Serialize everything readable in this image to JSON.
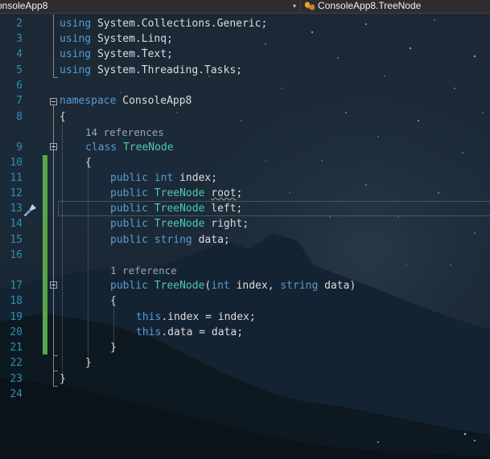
{
  "navbar": {
    "project_label": "onsoleApp8",
    "dropdown_arrow": "▾",
    "type_label": "ConsoleApp8.TreeNode",
    "type_icon": "class-icon"
  },
  "editor": {
    "line_numbers": [
      "2",
      "3",
      "4",
      "5",
      "6",
      "7",
      "8",
      "9",
      "10",
      "11",
      "12",
      "13",
      "14",
      "15",
      "16",
      "17",
      "18",
      "19",
      "20",
      "21",
      "22",
      "23",
      "24"
    ],
    "codelens": {
      "class_refs": "14 references",
      "ctor_refs": "1 reference"
    },
    "line_2": {
      "kw": "using",
      "rest": "System.Collections.Generic;"
    },
    "line_3": {
      "kw": "using",
      "rest": "System.Linq;"
    },
    "line_4": {
      "kw": "using",
      "rest": "System.Text;"
    },
    "line_5": {
      "kw": "using",
      "rest": "System.Threading.Tasks;"
    },
    "line_7": {
      "kw": "namespace",
      "name": "ConsoleApp8"
    },
    "line_8": {
      "brace": "{"
    },
    "line_9": {
      "kw": "class",
      "name": "TreeNode"
    },
    "line_10": {
      "brace": "{"
    },
    "line_11": {
      "kw1": "public",
      "kw2": "int",
      "name": "index;"
    },
    "line_12": {
      "kw1": "public",
      "type": "TreeNode",
      "name": "root",
      "end": ";"
    },
    "line_13": {
      "kw1": "public",
      "type": "TreeNode",
      "name": "left;"
    },
    "line_14": {
      "kw1": "public",
      "type": "TreeNode",
      "name": "right;"
    },
    "line_15": {
      "kw1": "public",
      "kw2": "string",
      "name": "data;"
    },
    "line_17": {
      "kw1": "public",
      "type": "TreeNode",
      "open": "(",
      "p1type": "int",
      "p1": "index,",
      "p2type": "string",
      "p2": "data)"
    },
    "line_18": {
      "brace": "{"
    },
    "line_19": {
      "kw": "this",
      "rest": ".index = index;"
    },
    "line_20": {
      "kw": "this",
      "rest": ".data = data;"
    },
    "line_21": {
      "brace": "}"
    },
    "line_22": {
      "brace": "}"
    },
    "line_23": {
      "brace": "}"
    }
  },
  "colors": {
    "keyword": "#569cd6",
    "type": "#4ec9b0",
    "text": "#dcdcdc",
    "line_number": "#2b91af",
    "change_bar": "#57a64a"
  },
  "glyph_margin": {
    "icon": "quick-actions-brush-icon"
  }
}
